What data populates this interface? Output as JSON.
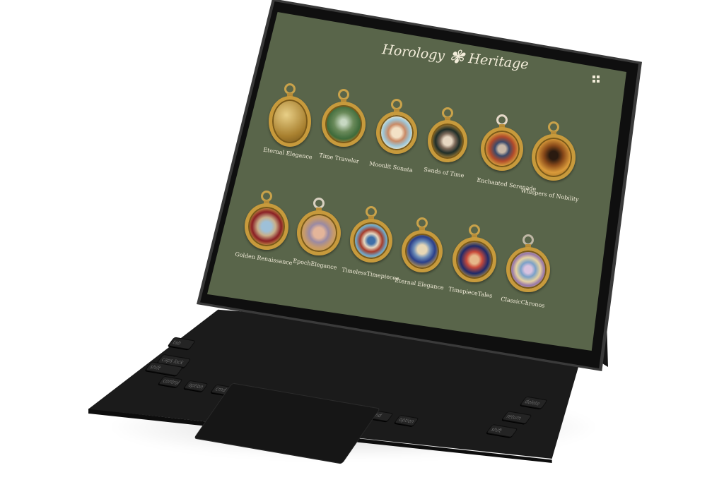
{
  "site": {
    "brand_left": "Horology",
    "brand_right": "Heritage",
    "logo_icon": "fleur-logo-icon",
    "menu_icon": "grid-menu-icon"
  },
  "watches_row1": [
    {
      "label": "Eternal Elegance",
      "icon": "pocket-watch-icon"
    },
    {
      "label": "Time Traveler",
      "icon": "pocket-watch-icon"
    },
    {
      "label": "Moonlit Sonata",
      "icon": "pocket-watch-icon"
    },
    {
      "label": "Sands of Time",
      "icon": "pocket-watch-icon"
    },
    {
      "label": "Enchanted Serenade",
      "icon": "pocket-watch-icon"
    },
    {
      "label": "Whispers of Nobility",
      "icon": "pocket-watch-icon"
    }
  ],
  "watches_row2": [
    {
      "label": "Golden Renaissance",
      "icon": "pocket-watch-icon"
    },
    {
      "label": "EpochElegance",
      "icon": "pocket-watch-icon"
    },
    {
      "label": "TimelessTimepieces",
      "icon": "pocket-watch-icon"
    },
    {
      "label": "Eternal Elegance",
      "icon": "pocket-watch-icon"
    },
    {
      "label": "TimepieceTales",
      "icon": "pocket-watch-icon"
    },
    {
      "label": "ClassicChronos",
      "icon": "pocket-watch-icon"
    }
  ],
  "keyboard": {
    "keys": [
      "tab",
      "caps lock",
      "shift",
      "control",
      "option",
      "cmd",
      "cmd",
      "option",
      "delete",
      "return",
      "shift"
    ]
  },
  "colors": {
    "screen_bg": "#59654a",
    "text": "#f2ecd9",
    "gold": "#c79a3c"
  }
}
